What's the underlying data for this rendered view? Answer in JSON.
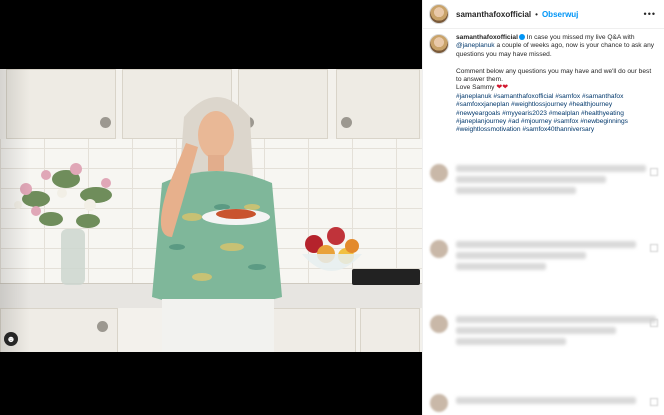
{
  "post": {
    "username": "samanthafoxofficial",
    "follow_label": "Obserwuj",
    "separator": "•",
    "more_icon": "more-horizontal-icon"
  },
  "caption": {
    "username": "samanthafoxofficial",
    "line1": "In case you missed my live Q&A with",
    "mention": "@janeplanuk",
    "line2": "a couple of weeks ago, now is your chance to ask any questions you may have missed.",
    "line3": "Comment below any questions you may have and we'll do our best to answer them.",
    "signoff": "Love Sammy",
    "hearts": "❤❤",
    "hashtags": "#janeplanuk #samanthafoxofficial #samfox #samanthafox #samfoxxjaneplan #weightlossjourney #healthjourney #newyeargoals #myyearis2023 #mealplan #healthyeating #janeplanjourney #ad #mjourney #samfox #newbeginnings #weightlossmotivation #samfox40thanniversary"
  },
  "media": {
    "tag_icon": "person-tag-icon"
  }
}
